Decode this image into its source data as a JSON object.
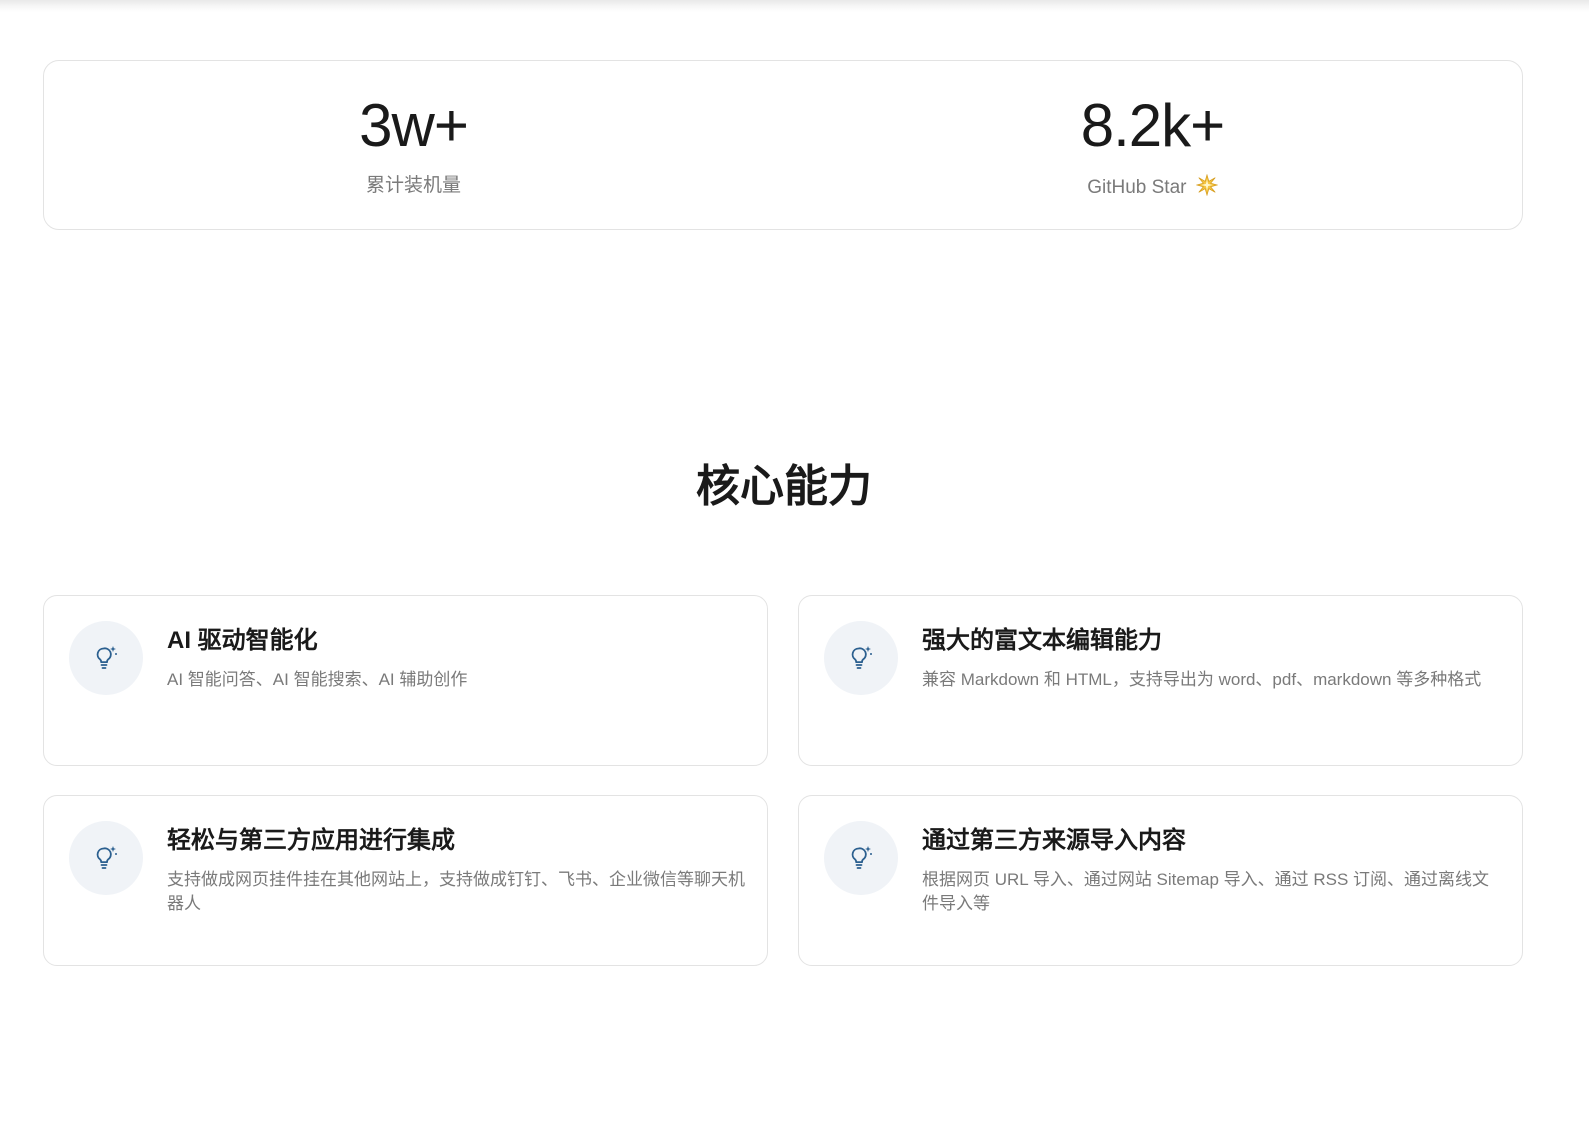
{
  "stats": [
    {
      "value": "3w+",
      "label": "累计装机量"
    },
    {
      "value": "8.2k+",
      "label": "GitHub Star"
    }
  ],
  "stats_icon": "sparkle-emoji-icon",
  "section": {
    "title": "核心能力"
  },
  "features": [
    {
      "icon": "lightbulb-icon",
      "title": "AI 驱动智能化",
      "desc": "AI 智能问答、AI 智能搜索、AI 辅助创作"
    },
    {
      "icon": "lightbulb-icon",
      "title": "强大的富文本编辑能力",
      "desc": "兼容 Markdown 和 HTML，支持导出为 word、pdf、markdown 等多种格式"
    },
    {
      "icon": "lightbulb-icon",
      "title": "轻松与第三方应用进行集成",
      "desc": "支持做成网页挂件挂在其他网站上，支持做成钉钉、飞书、企业微信等聊天机器人"
    },
    {
      "icon": "lightbulb-icon",
      "title": "通过第三方来源导入内容",
      "desc": "根据网页 URL 导入、通过网站 Sitemap 导入、通过 RSS 订阅、通过离线文件导入等"
    }
  ],
  "colors": {
    "icon_stroke": "#2b5f8f",
    "icon_bg": "#f0f3f7",
    "border": "#e3e3e3",
    "muted_text": "#7a7a7a"
  }
}
